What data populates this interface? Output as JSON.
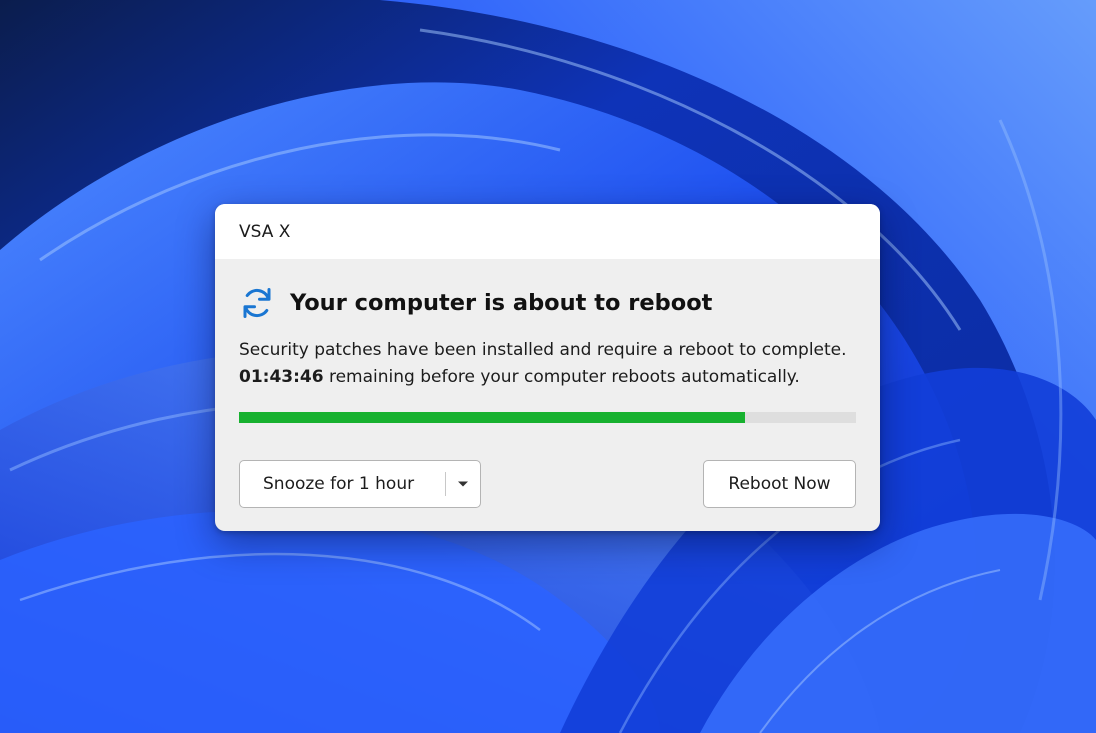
{
  "dialog": {
    "app_name": "VSA X",
    "heading": "Your computer is about to reboot",
    "icon": "refresh-icon",
    "message_line1": "Security patches have been installed and require a reboot to complete.",
    "countdown": "01:43:46",
    "message_line2_suffix": " remaining before your computer reboots automatically.",
    "progress_percent": 82
  },
  "actions": {
    "snooze_label": "Snooze for 1 hour",
    "snooze_icon": "chevron-down-icon",
    "reboot_label": "Reboot Now"
  },
  "colors": {
    "progress_fill": "#17b12f",
    "progress_track": "#dedede",
    "icon_blue": "#1a76d2",
    "wallpaper_blue": "#1d4ff0"
  }
}
